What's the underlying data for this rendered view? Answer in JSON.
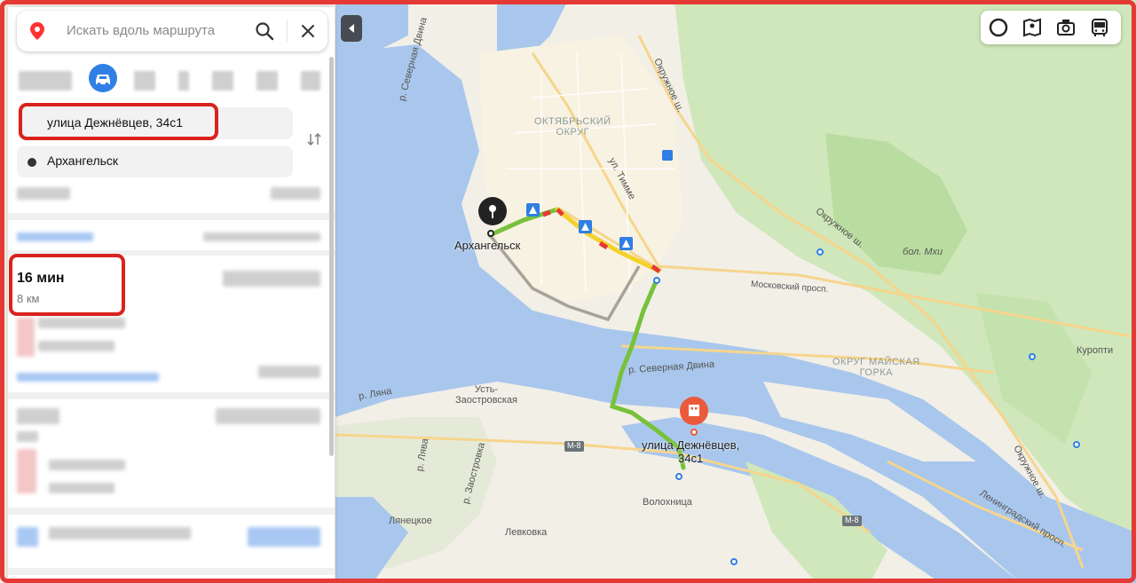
{
  "search": {
    "placeholder": "Искать вдоль маршрута"
  },
  "route": {
    "from": "улица Дежнёвцев, 34с1",
    "to": "Архангельск",
    "time": "16 мин",
    "distance": "8 км"
  },
  "map": {
    "labels": {
      "oktyabrsky": "ОКТЯБРЬСКИЙ\nОКРУГ",
      "maimaks": "ОКРУГ МАЙСКАЯ\nГОРКА",
      "north_dvina_1": "р. Северная Двина",
      "north_dvina_2": "р. Северная Двина",
      "timme": "ул. Тимме",
      "okruzhnoe_1": "Окружное ш.",
      "okruzhnoe_2": "Окружное ш.",
      "okruzhnoe_3": "Окружное ш.",
      "moskovsky": "Московский просп.",
      "bol_mkhi": "бол. Мхи",
      "kuropti": "Куропти",
      "ust_zaostrovskaya": "Усть-\nЗаостровская",
      "lyana": "р. Ляна",
      "lyanetskoe": "Лянецкое",
      "levkovka": "Левковка",
      "volokhnitsa": "Волохница",
      "leningradsky": "Ленинградский просп.",
      "m8_1": "М-8",
      "m8_2": "М-8",
      "arkhangelsk": "Архангельск",
      "destination": "улица Дежнёвцев,\n34с1",
      "zaostrovka": "р. Заостровка",
      "dyna": "р. Лява"
    }
  },
  "colors": {
    "accent": "#2f7fe5",
    "highlight": "#d9231d",
    "route_fast": "#78c13a",
    "route_slow": "#f3d22b",
    "route_jam": "#e53935",
    "water": "#a9c7ec",
    "land": "#f3f0e8",
    "green": "#cbe6b5"
  }
}
